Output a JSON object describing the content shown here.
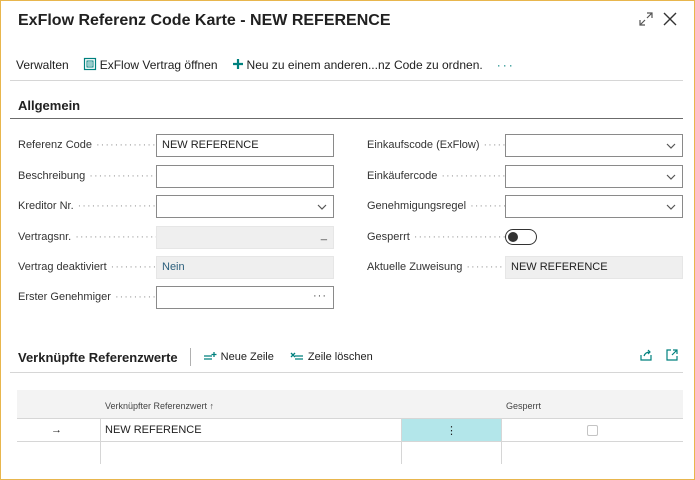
{
  "window": {
    "title": "ExFlow Referenz Code Karte - NEW REFERENCE",
    "expand_icon": "expand-diagonal-arrows-icon",
    "close_icon": "close-x-icon"
  },
  "actionbar": {
    "manage": "Verwalten",
    "open_contract": "ExFlow Vertrag öffnen",
    "assign_new": "Neu zu einem anderen...nz Code zu ordnen.",
    "more": "···"
  },
  "general": {
    "section_title": "Allgemein",
    "left": [
      {
        "label": "Referenz Code",
        "value": "NEW REFERENCE"
      },
      {
        "label": "Beschreibung",
        "value": ""
      },
      {
        "label": "Kreditor Nr.",
        "value": ""
      },
      {
        "label": "Vertragsnr.",
        "value": "",
        "suffix": "_"
      },
      {
        "label": "Vertrag deaktiviert",
        "value": "Nein"
      },
      {
        "label": "Erster Genehmiger",
        "value": "",
        "suffix": "···"
      }
    ],
    "right": [
      {
        "label": "Einkaufscode (ExFlow)",
        "value": ""
      },
      {
        "label": "Einkäufercode",
        "value": ""
      },
      {
        "label": "Genehmigungsregel",
        "value": ""
      },
      {
        "label": "Gesperrt",
        "value": "off"
      },
      {
        "label": "Aktuelle Zuweisung",
        "value": "NEW REFERENCE"
      }
    ]
  },
  "linked": {
    "title": "Verknüpfte Referenzwerte",
    "new_line": "Neue Zeile",
    "delete_line": "Zeile löschen",
    "columns": {
      "value": "Verknüpfter Referenzwert ↑",
      "blocked": "Gesperrt"
    },
    "rows": [
      {
        "arrow": "→",
        "value": "NEW REFERENCE",
        "menu": "⋮"
      }
    ]
  }
}
